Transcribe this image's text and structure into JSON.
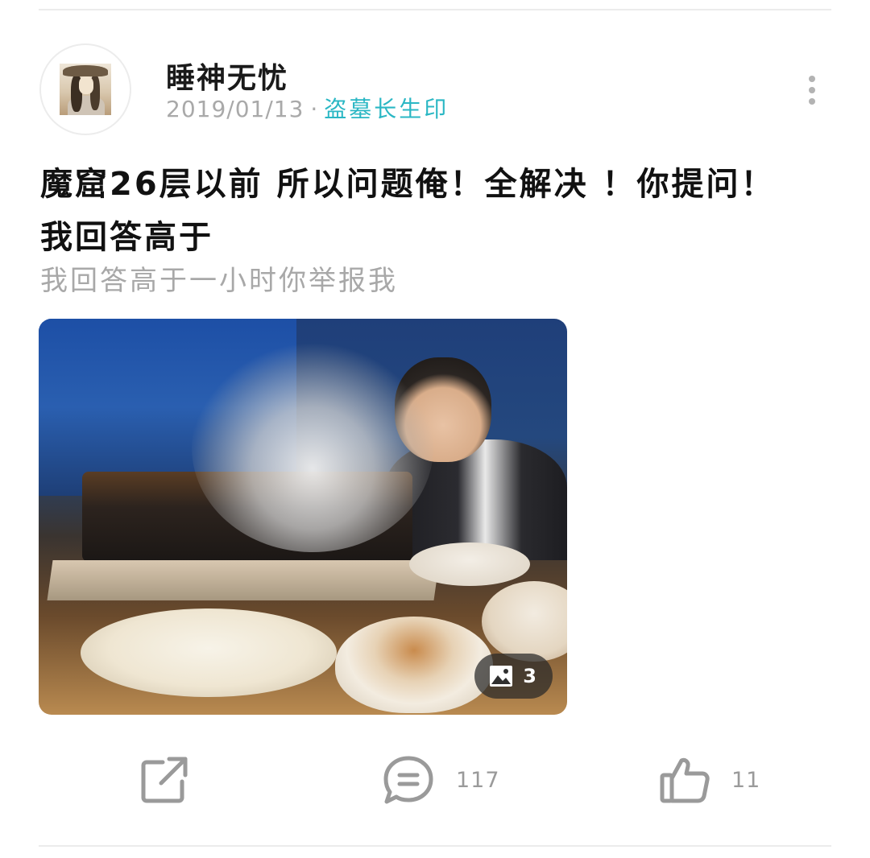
{
  "post": {
    "author": {
      "name": "睡神无忧"
    },
    "date": "2019/01/13",
    "separator": "·",
    "topic": "盗墓长生印",
    "title": "魔窟26层以前 所以问题俺！全解决 ！你提问！我回答高于",
    "summary": "我回答高于一小时你举报我",
    "image": {
      "count": "3"
    },
    "actions": {
      "share": {
        "icon": "share-icon"
      },
      "comment": {
        "icon": "comment-icon",
        "count": "117"
      },
      "like": {
        "icon": "thumbs-up-icon",
        "count": "11"
      }
    }
  },
  "colors": {
    "topic": "#2ab7c4",
    "meta_gray": "#a9a9a9",
    "icon_gray": "#9a9a9a",
    "divider": "#ececec"
  }
}
